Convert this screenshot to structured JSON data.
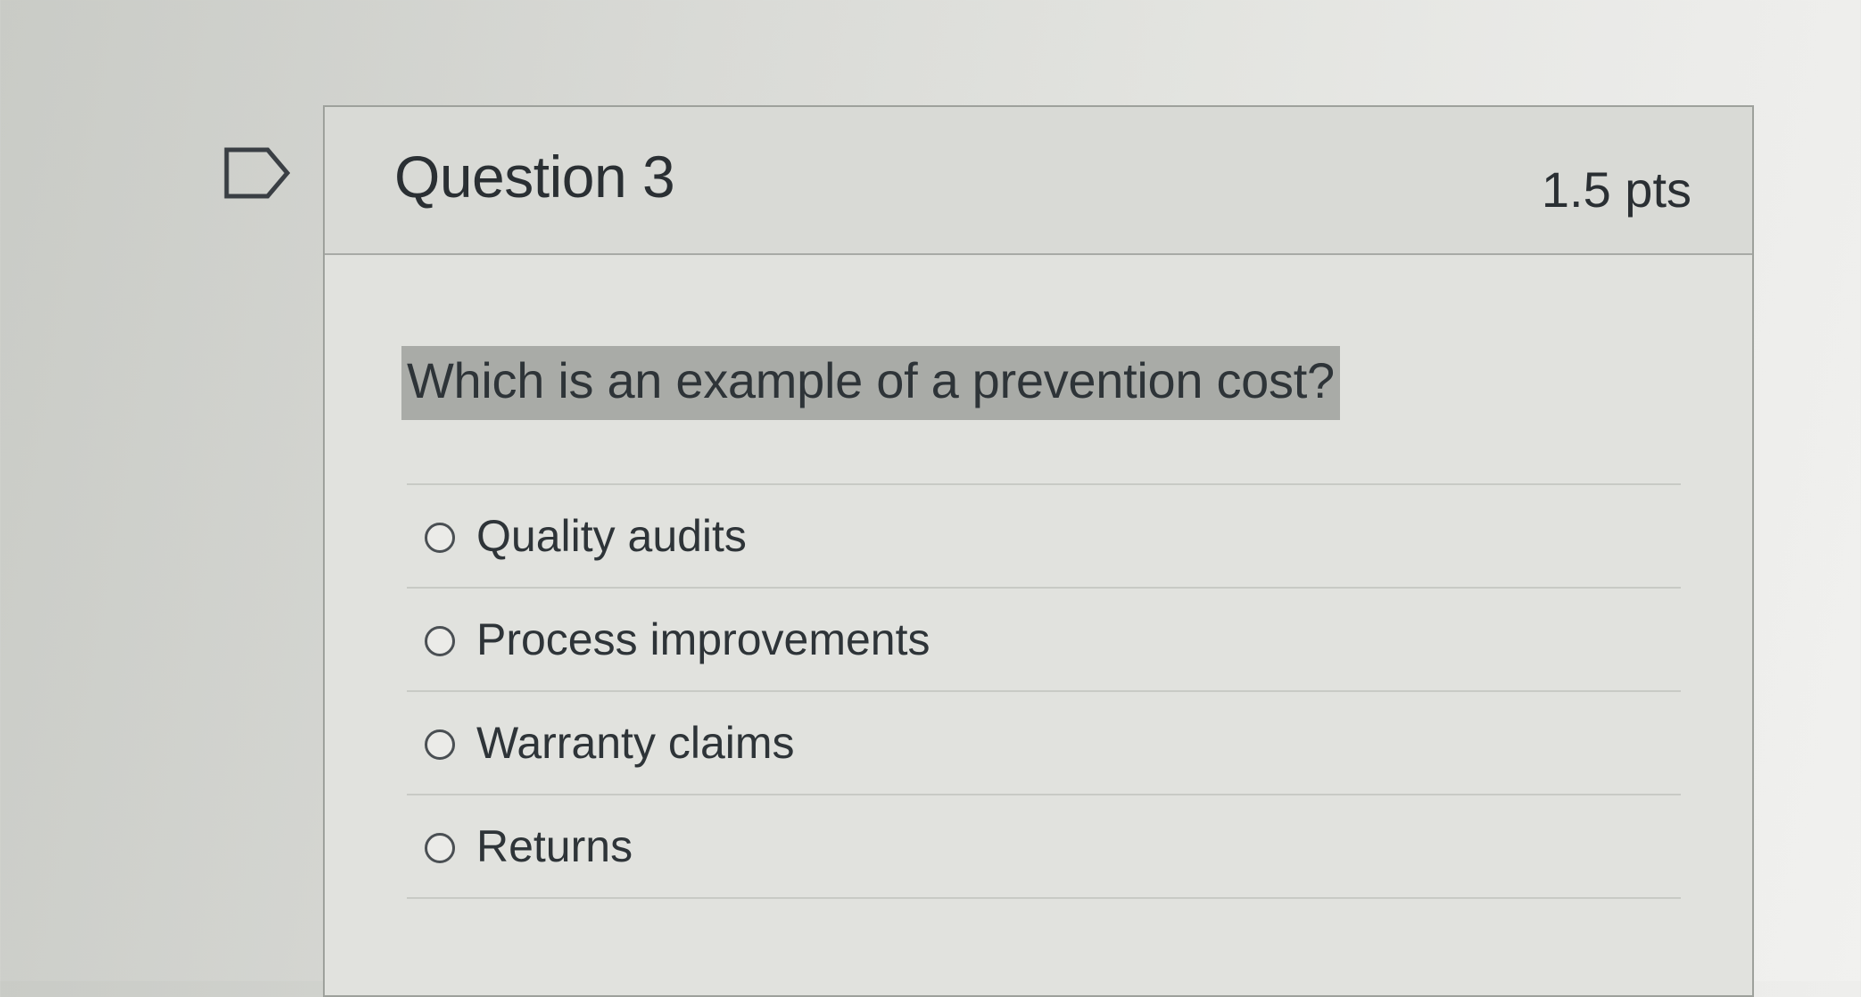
{
  "question": {
    "title": "Question 3",
    "points": "1.5 pts",
    "text": "Which is an example of a prevention cost?",
    "flag_icon": "flag-bookmark-icon"
  },
  "answers": [
    {
      "label": "Quality audits"
    },
    {
      "label": "Process improvements"
    },
    {
      "label": "Warranty claims"
    },
    {
      "label": "Returns"
    }
  ]
}
